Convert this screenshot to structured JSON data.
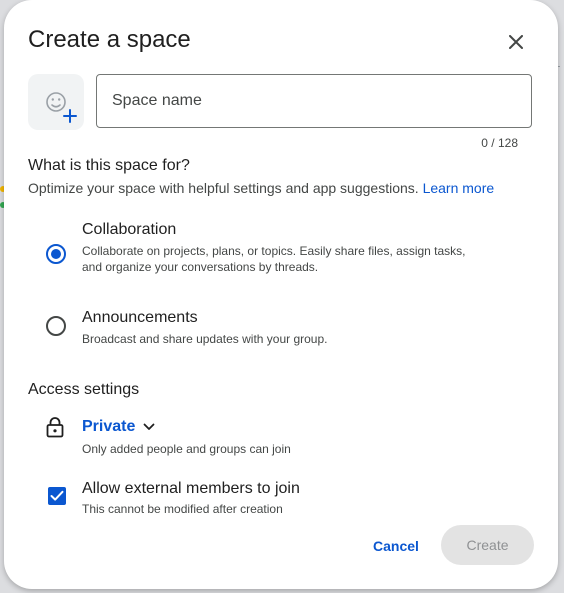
{
  "dialog": {
    "title": "Create a space",
    "space_name": {
      "placeholder": "Space name",
      "value": "",
      "counter": "0 / 128"
    },
    "purpose": {
      "heading": "What is this space for?",
      "subtitle": "Optimize your space with helpful settings and app suggestions.",
      "learn_more": "Learn more",
      "options": [
        {
          "label": "Collaboration",
          "description": "Collaborate on projects, plans, or topics. Easily share files, assign tasks, and organize your conversations by threads.",
          "selected": true
        },
        {
          "label": "Announcements",
          "description": "Broadcast and share updates with your group.",
          "selected": false
        }
      ]
    },
    "access": {
      "heading": "Access settings",
      "value": "Private",
      "description": "Only added people and groups can join"
    },
    "external": {
      "label": "Allow external members to join",
      "description": "This cannot be modified after creation",
      "checked": true
    },
    "actions": {
      "cancel": "Cancel",
      "create": "Create"
    }
  },
  "icons": [
    "close-icon",
    "add-emoji-icon",
    "radio-checked-icon",
    "radio-unchecked-icon",
    "lock-icon",
    "chevron-down-icon",
    "checkbox-checked-icon"
  ],
  "colors": {
    "accent": "#0b57d0",
    "text": "#1f1f1f",
    "secondary_text": "#444746",
    "disabled_button": "#e3e3e3"
  }
}
